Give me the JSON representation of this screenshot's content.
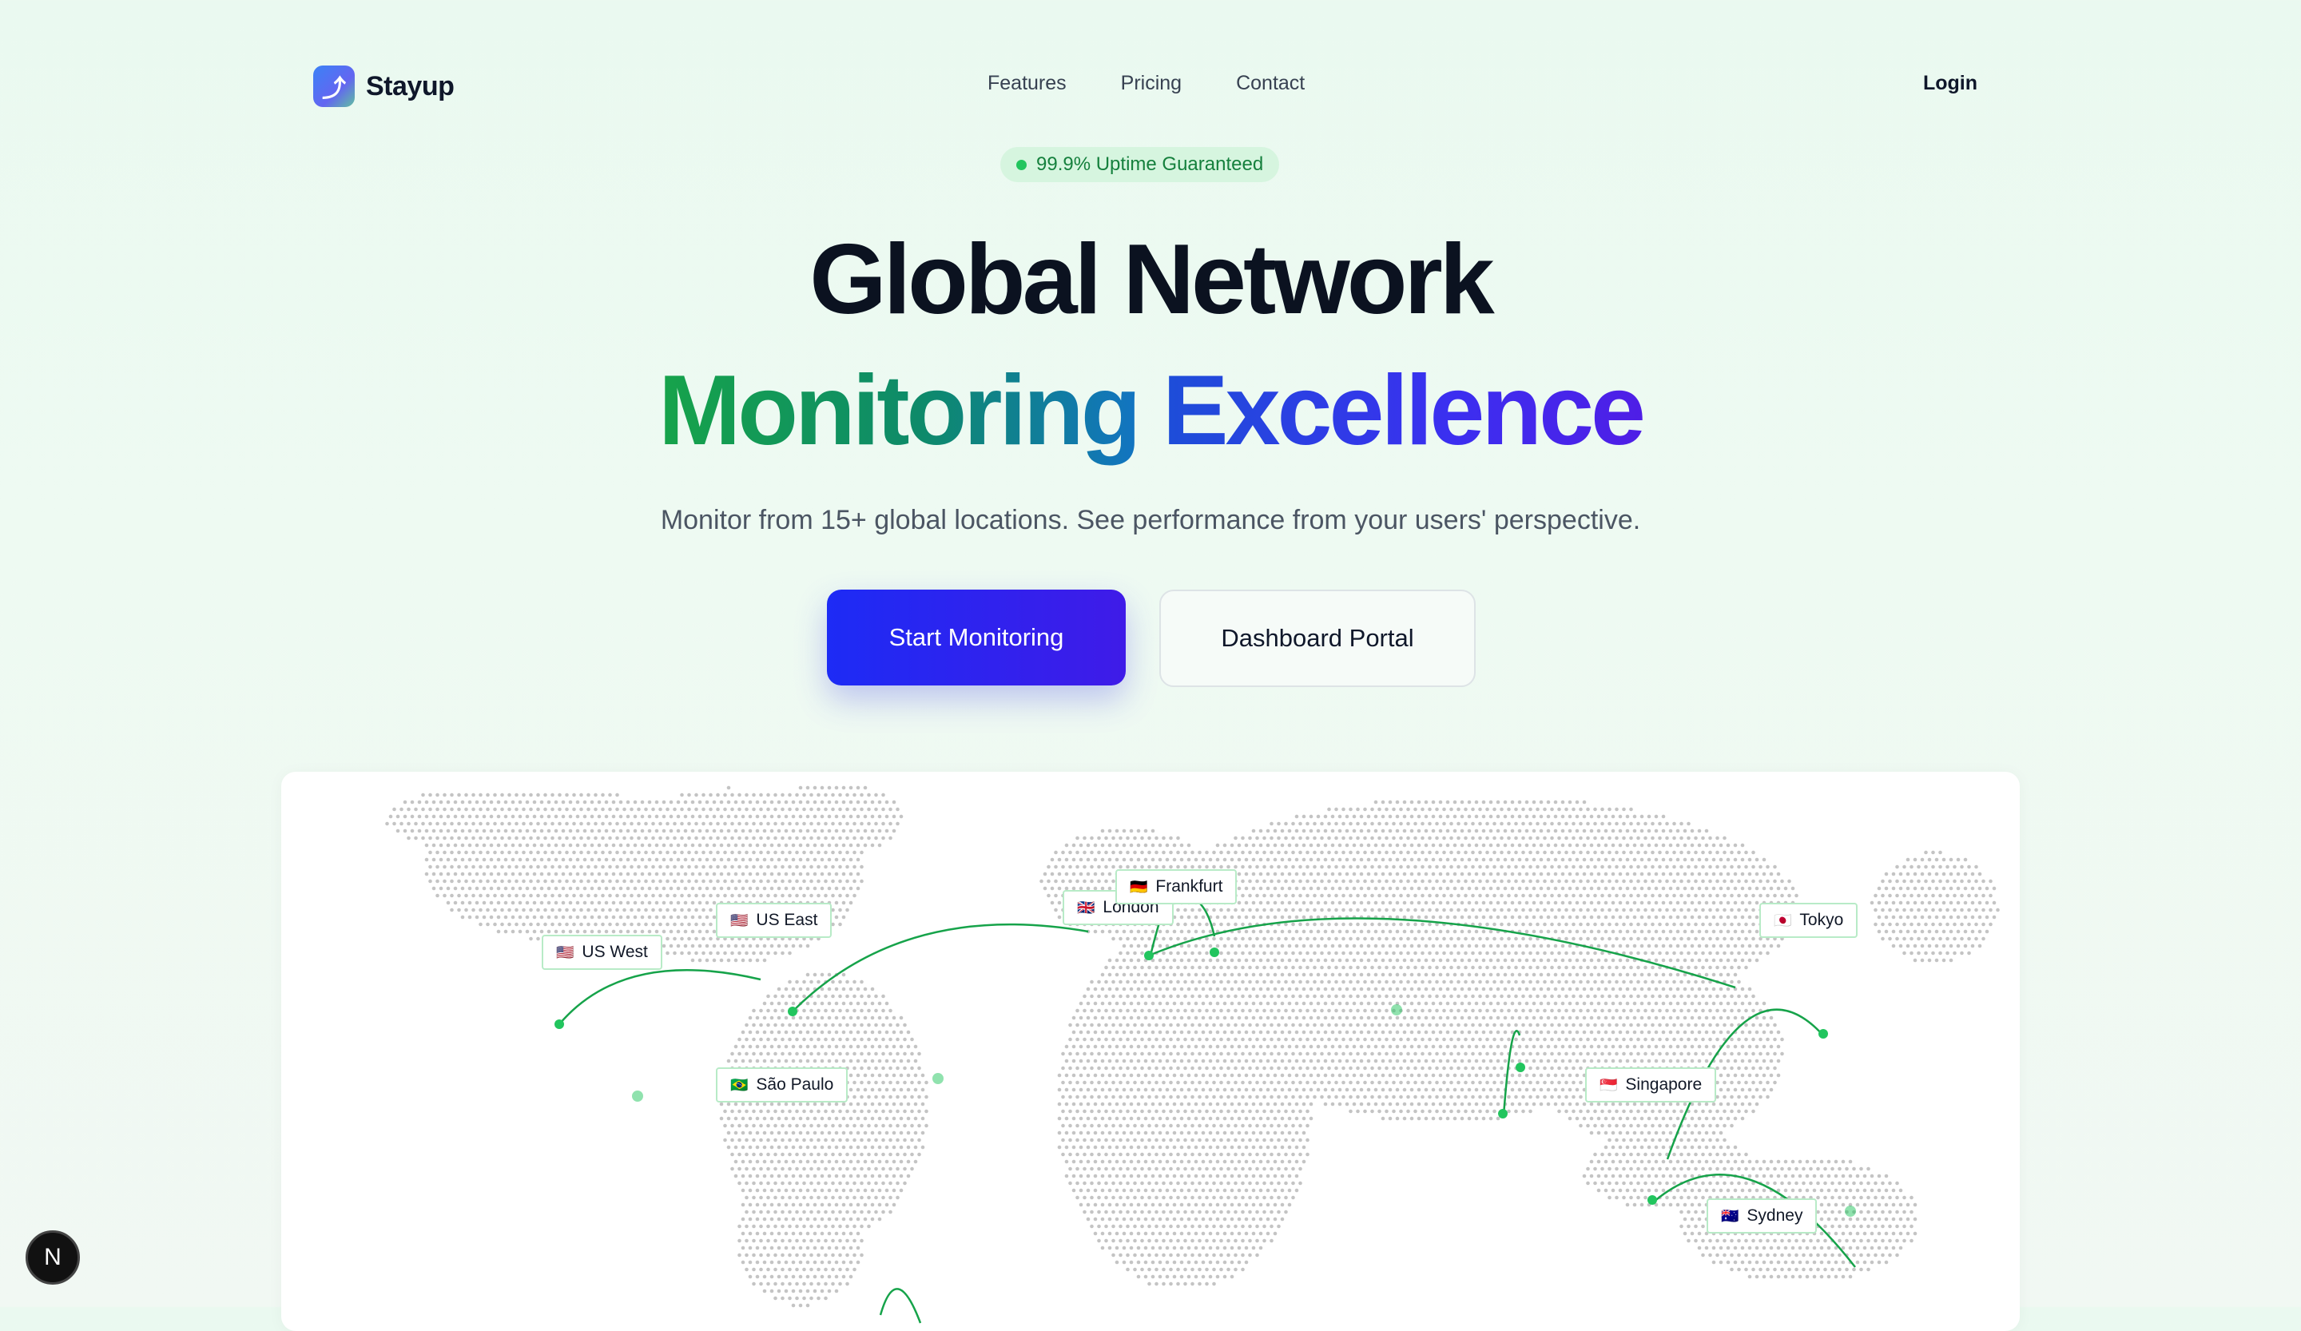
{
  "brand": {
    "name": "Stayup",
    "logo_icon": "upload-arrow-icon"
  },
  "nav": {
    "links": [
      "Features",
      "Pricing",
      "Contact"
    ],
    "login": "Login"
  },
  "badge": {
    "text": "99.9% Uptime Guaranteed"
  },
  "hero": {
    "title_line1": "Global Network",
    "title_line2_a": "Monitoring",
    "title_line2_b": "Excellence",
    "subtitle": "Monitor from 15+ global locations. See performance from your users' perspective."
  },
  "buttons": {
    "primary": "Start Monitoring",
    "secondary": "Dashboard Portal"
  },
  "locations": [
    {
      "name": "US West",
      "flag": "🇺🇸"
    },
    {
      "name": "US East",
      "flag": "🇺🇸"
    },
    {
      "name": "São Paulo",
      "flag": "🇧🇷"
    },
    {
      "name": "London",
      "flag": "🇬🇧"
    },
    {
      "name": "Frankfurt",
      "flag": "🇩🇪"
    },
    {
      "name": "Tokyo",
      "flag": "🇯🇵"
    },
    {
      "name": "Singapore",
      "flag": "🇸🇬"
    },
    {
      "name": "Sydney",
      "flag": "🇦🇺"
    }
  ],
  "colors": {
    "accent_green": "#22c55e",
    "primary_blue": "#1d2bf5",
    "arc_green": "#16a34a"
  },
  "dev_badge": {
    "letter": "N"
  }
}
